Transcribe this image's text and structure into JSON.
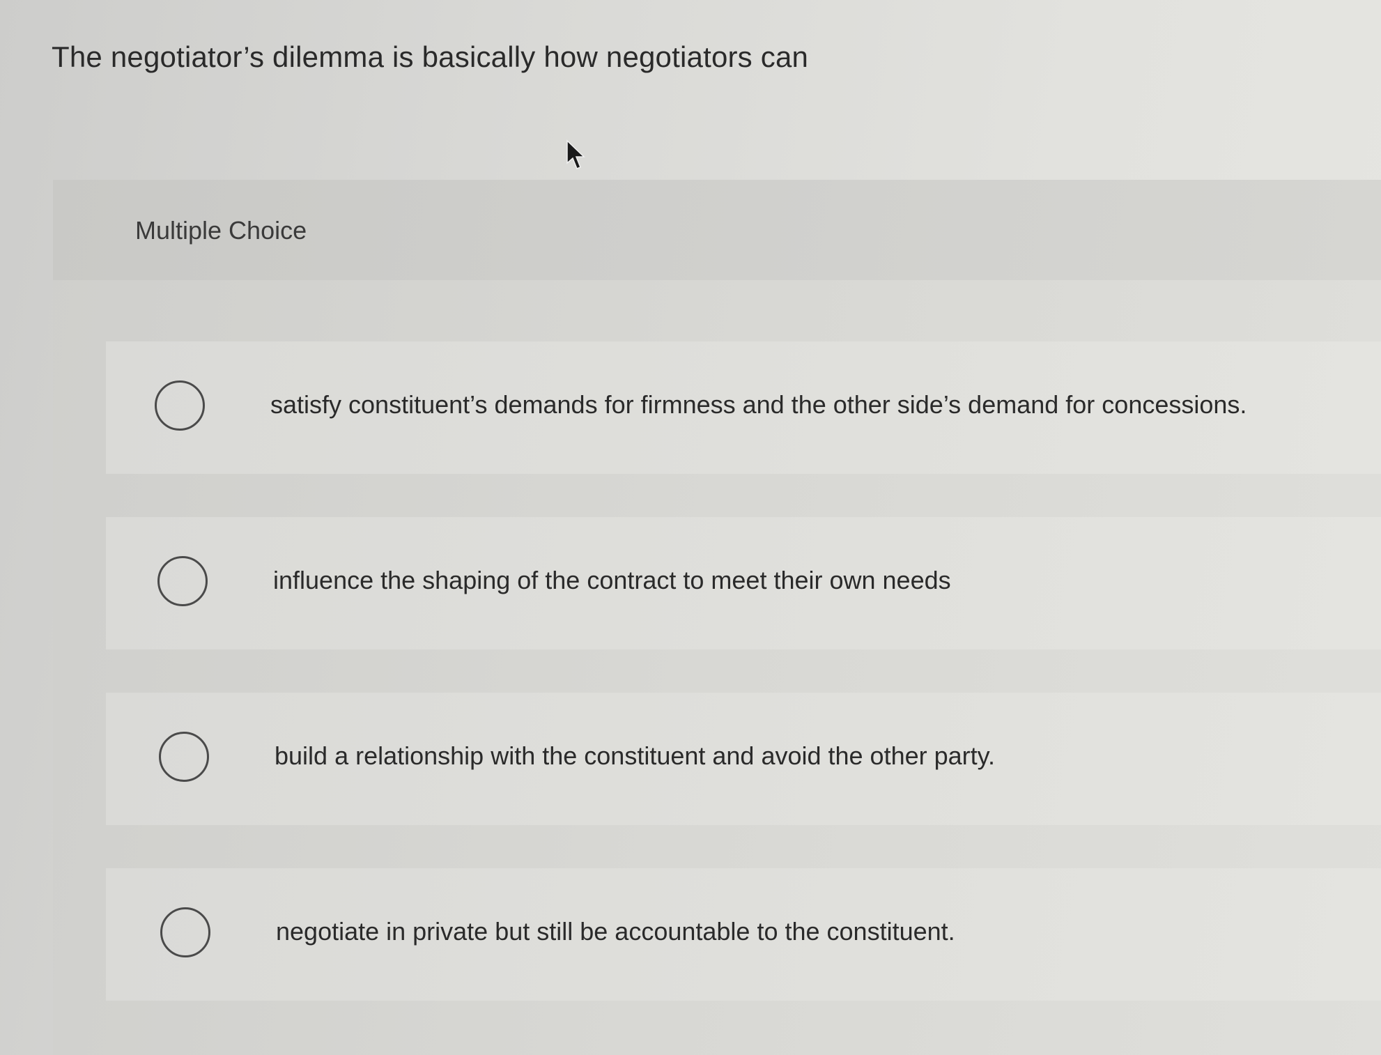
{
  "question": {
    "text": "The negotiator’s dilemma is basically how negotiators can"
  },
  "question_type": {
    "label": "Multiple Choice"
  },
  "options": [
    {
      "label": "satisfy constituent’s demands for firmness and the other side’s demand for concessions.",
      "selected": false
    },
    {
      "label": "influence the shaping of the contract to meet their own needs",
      "selected": false
    },
    {
      "label": "build a relationship with the constituent and avoid the other party.",
      "selected": false
    },
    {
      "label": "negotiate in private but still be accountable to the constituent.",
      "selected": false
    }
  ],
  "icons": {
    "cursor": "mouse-pointer-icon",
    "radio": "radio-unchecked-icon"
  }
}
